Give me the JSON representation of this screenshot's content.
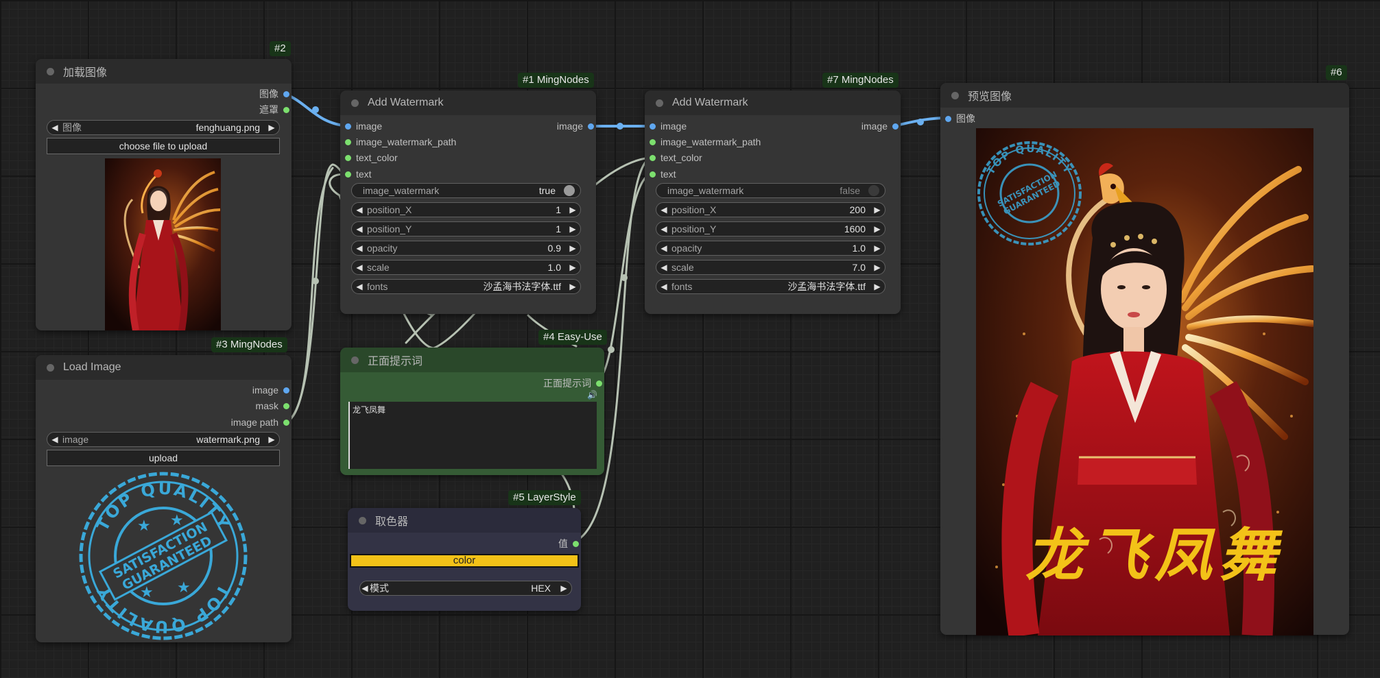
{
  "load_image_1": {
    "badge": "#2",
    "title": "加载图像",
    "outputs": [
      "图像",
      "遮罩"
    ],
    "image_widget": {
      "label": "图像",
      "value": "fenghuang.png"
    },
    "upload_label": "choose file to upload"
  },
  "load_image_2": {
    "badge": "#3 MingNodes",
    "title": "Load Image",
    "outputs": [
      "image",
      "mask",
      "image path"
    ],
    "image_widget": {
      "label": "image",
      "value": "watermark.png"
    },
    "upload_label": "upload",
    "stamp_text": {
      "top": "TOP QUALITY",
      "middle_1": "SATISFACTION",
      "middle_2": "GUARANTEED",
      "bottom": "TOP QUALITY"
    }
  },
  "watermark_1": {
    "badge": "#1 MingNodes",
    "title": "Add Watermark",
    "inputs": [
      "image",
      "image_watermark_path",
      "text_color",
      "text"
    ],
    "output": "image",
    "toggle": {
      "label": "image_watermark",
      "value": "true"
    },
    "widgets": [
      {
        "label": "position_X",
        "value": "1"
      },
      {
        "label": "position_Y",
        "value": "1"
      },
      {
        "label": "opacity",
        "value": "0.9"
      },
      {
        "label": "scale",
        "value": "1.0"
      },
      {
        "label": "fonts",
        "value": "沙孟海书法字体.ttf"
      }
    ]
  },
  "watermark_2": {
    "badge": "#7 MingNodes",
    "title": "Add Watermark",
    "inputs": [
      "image",
      "image_watermark_path",
      "text_color",
      "text"
    ],
    "output": "image",
    "toggle": {
      "label": "image_watermark",
      "value": "false"
    },
    "widgets": [
      {
        "label": "position_X",
        "value": "200"
      },
      {
        "label": "position_Y",
        "value": "1600"
      },
      {
        "label": "opacity",
        "value": "1.0"
      },
      {
        "label": "scale",
        "value": "7.0"
      },
      {
        "label": "fonts",
        "value": "沙孟海书法字体.ttf"
      }
    ]
  },
  "prompt": {
    "badge": "#4 Easy-Use",
    "title": "正面提示词",
    "output": "正面提示词",
    "text": "龙飞凤舞"
  },
  "color_picker": {
    "badge": "#5 LayerStyle",
    "title": "取色器",
    "output": "值",
    "color_label": "color",
    "color_value": "#f3c218",
    "mode_label": "模式",
    "mode_value": "HEX"
  },
  "preview": {
    "badge": "#6",
    "title": "预览图像",
    "input": "图像",
    "calligraphy": "龙飞凤舞",
    "stamp_text": {
      "top": "TOP QUALITY",
      "middle_1": "SATISFACTION",
      "middle_2": "GUARANTEED"
    }
  },
  "colors": {
    "canvas": "#202020",
    "node_body": "#353535",
    "node_header": "#2b2b2b",
    "badge_bg": "#183418",
    "pin_image": "#5fa7f0",
    "pin_other": "#7cdf6e",
    "wire_image": "#6bb0f0",
    "wire_other": "#b7c2b3",
    "prompt_node": "#355b35",
    "picker_node": "#333345"
  }
}
